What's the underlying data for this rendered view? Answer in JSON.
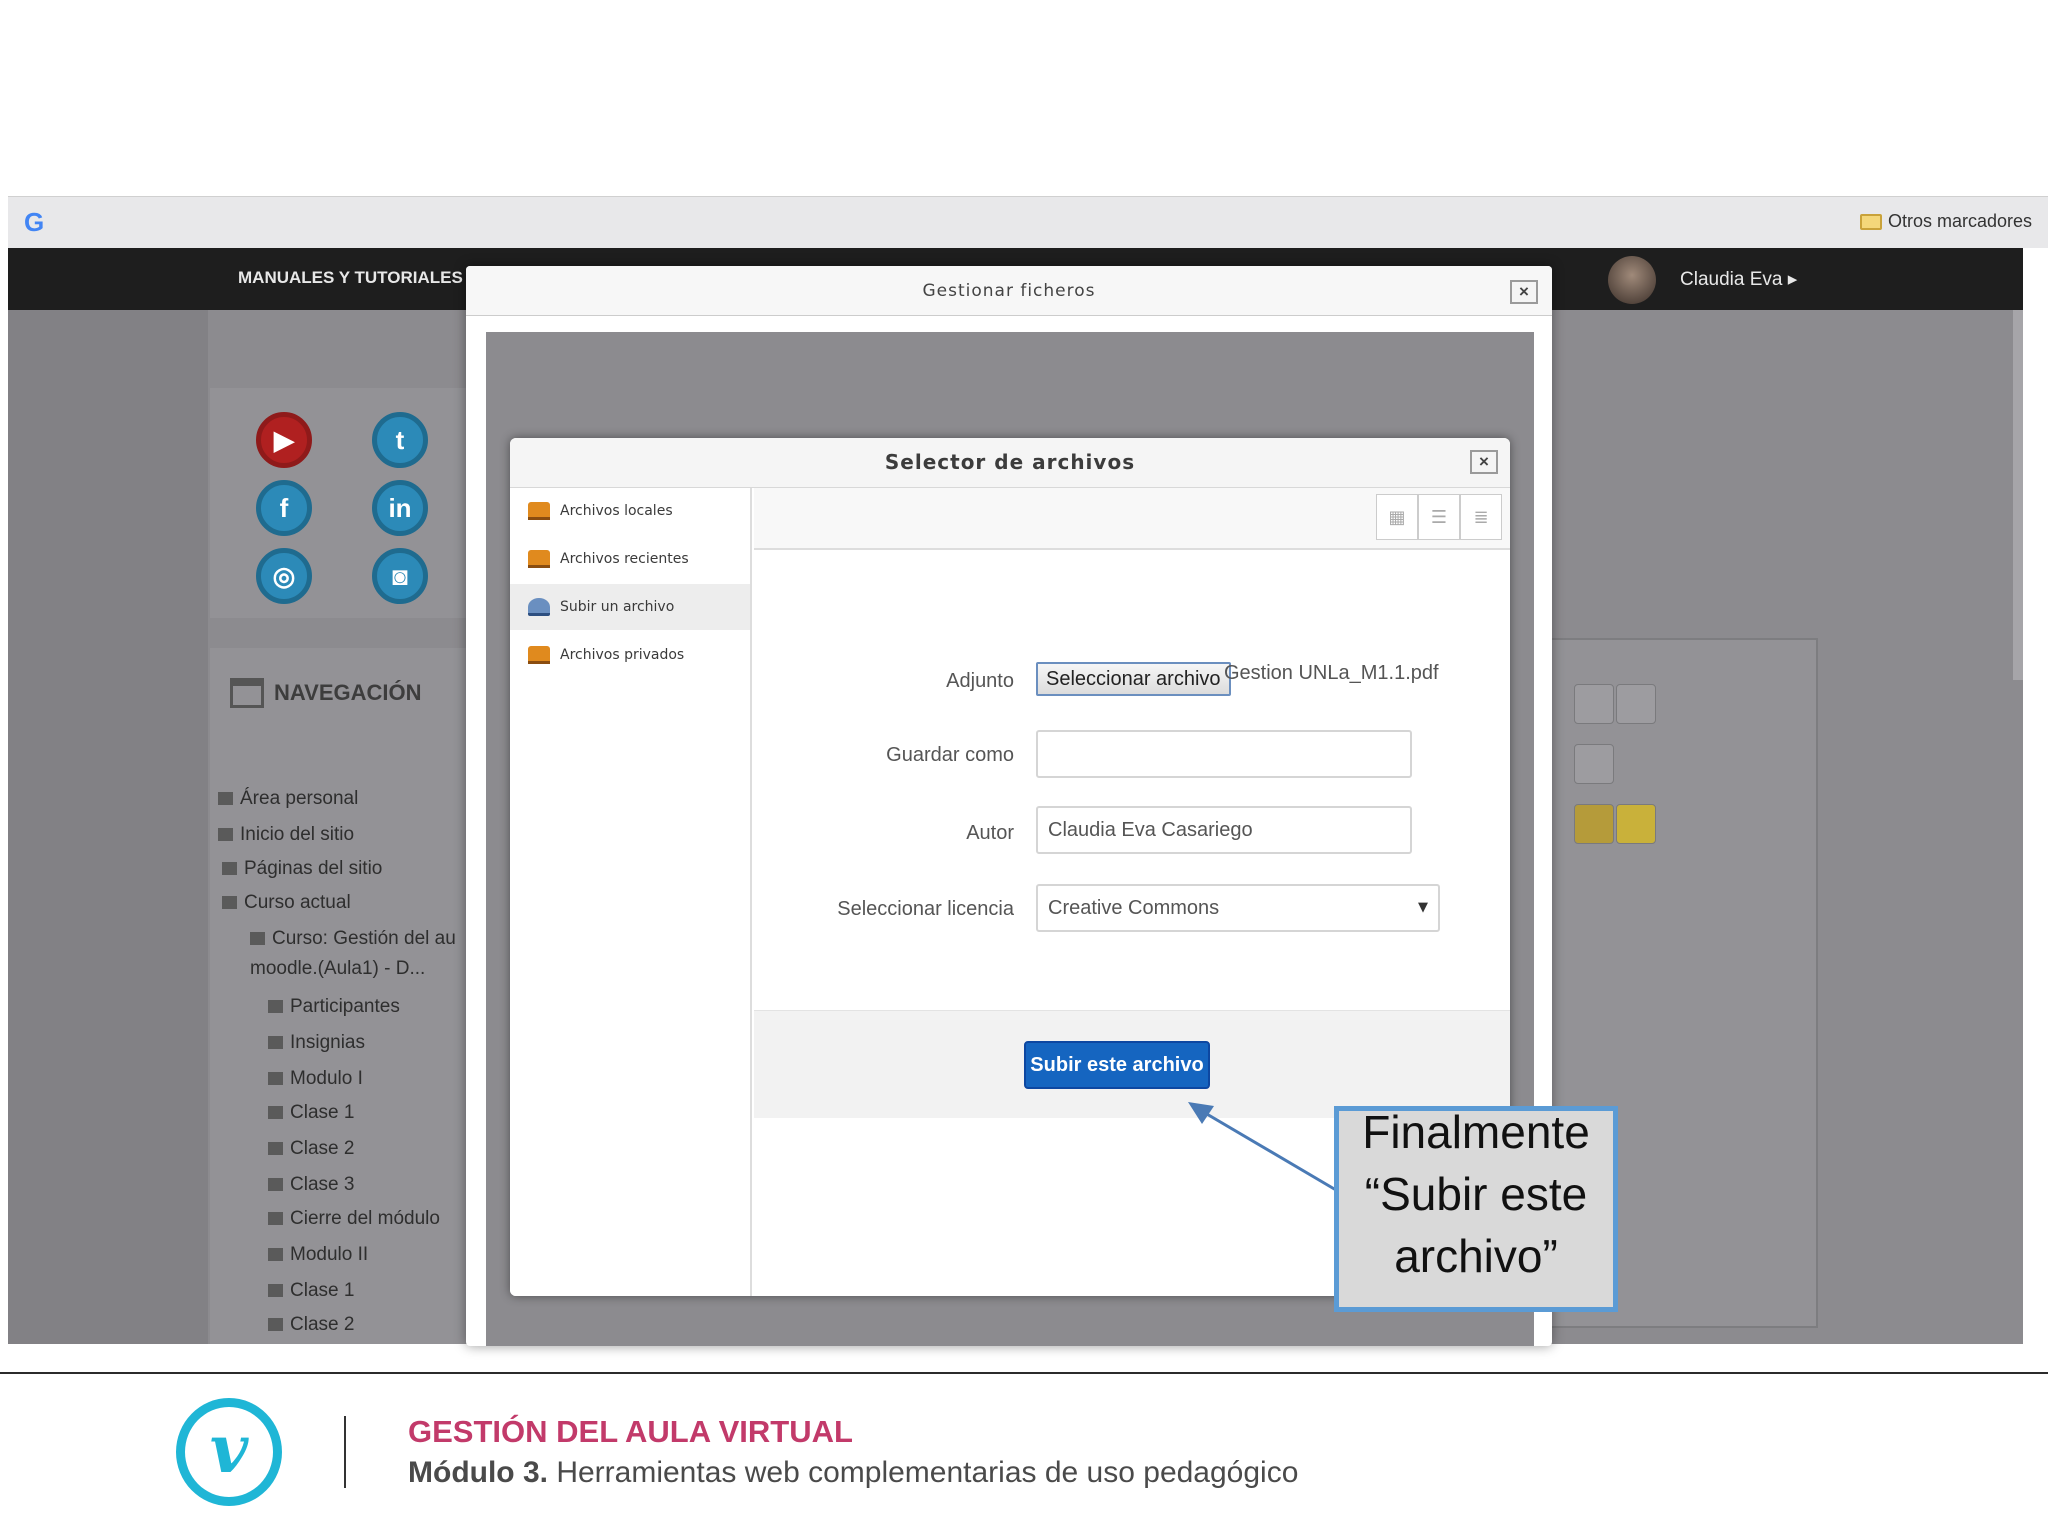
{
  "browser": {
    "bookmark_folder_label": "Otros marcadores",
    "google_logo_letter": "G"
  },
  "moodle": {
    "top_menu_label": "MANUALES Y TUTORIALES ▸",
    "user_name": "Claudia Eva ▸",
    "social_icons": [
      "youtube-icon",
      "twitter-icon",
      "facebook-icon",
      "linkedin-icon",
      "circle-icon",
      "camera-icon"
    ],
    "navigation": {
      "title": "NAVEGACIÓN",
      "items": [
        {
          "label": "Área personal",
          "level": 0
        },
        {
          "label": "Inicio del sitio",
          "level": 0
        },
        {
          "label": "Páginas del sitio",
          "level": 1
        },
        {
          "label": "Curso actual",
          "level": 1
        },
        {
          "label": "Curso: Gestión del au",
          "level": 2
        },
        {
          "label": "moodle.(Aula1) - D...",
          "level": 2
        },
        {
          "label": "Participantes",
          "level": 3
        },
        {
          "label": "Insignias",
          "level": 3
        },
        {
          "label": "Modulo I",
          "level": 3
        },
        {
          "label": "Clase 1",
          "level": 3
        },
        {
          "label": "Clase 2",
          "level": 3
        },
        {
          "label": "Clase 3",
          "level": 3
        },
        {
          "label": "Cierre del módulo",
          "level": 3
        },
        {
          "label": "Modulo II",
          "level": 3
        },
        {
          "label": "Clase 1",
          "level": 3
        },
        {
          "label": "Clase 2",
          "level": 3
        }
      ]
    }
  },
  "file_manager": {
    "title": "Gestionar ficheros",
    "close_label": "×"
  },
  "file_picker": {
    "title": "Selector de archivos",
    "close_label": "×",
    "repositories": [
      {
        "label": "Archivos locales",
        "active": false
      },
      {
        "label": "Archivos recientes",
        "active": false
      },
      {
        "label": "Subir un archivo",
        "active": true
      },
      {
        "label": "Archivos privados",
        "active": false
      }
    ],
    "view_modes": [
      "icons-view-icon",
      "list-view-icon",
      "tree-view-icon"
    ],
    "form": {
      "attachment_label": "Adjunto",
      "choose_file_button": "Seleccionar archivo",
      "chosen_file_name": "Gestion UNLa_M1.1.pdf",
      "save_as_label": "Guardar como",
      "save_as_value": "",
      "author_label": "Autor",
      "author_value": "Claudia Eva Casariego",
      "license_label": "Seleccionar licencia",
      "license_value": "Creative Commons"
    },
    "upload_button": "Subir este archivo"
  },
  "callout": {
    "text": "Finalmente “Subir este archivo”",
    "border_color": "#5b9bd5"
  },
  "footer": {
    "logo_letter": "v",
    "title": "GESTIÓN DEL AULA VIRTUAL",
    "subtitle_bold": "Módulo 3.",
    "subtitle_rest": " Herramientas web complementarias de uso pedagógico",
    "title_color": "#c23a6a",
    "logo_color": "#1fb6d6"
  }
}
